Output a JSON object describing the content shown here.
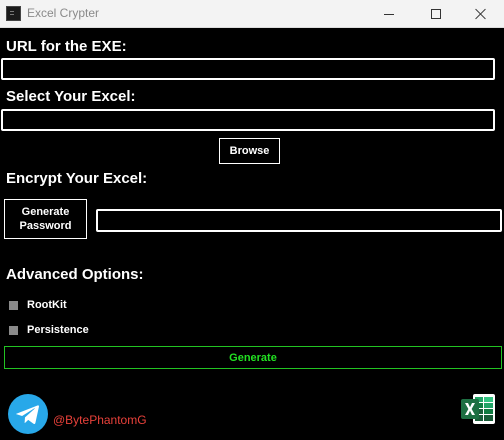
{
  "window": {
    "title": "Excel Crypter",
    "controls": [
      "minimize-icon",
      "maximize-icon",
      "close-icon"
    ]
  },
  "url_section": {
    "label": "URL for the EXE:",
    "value": ""
  },
  "excel_section": {
    "label": "Select Your Excel:",
    "value": "",
    "browse_label": "Browse"
  },
  "encrypt_section": {
    "label": "Encrypt Your Excel:",
    "generate_password_line1": "Generate",
    "generate_password_line2": "Password",
    "password_value": ""
  },
  "advanced": {
    "label": "Advanced Options:",
    "options": [
      {
        "label": "RootKit",
        "checked": false
      },
      {
        "label": "Persistence",
        "checked": false
      }
    ]
  },
  "generate_label": "Generate",
  "footer": {
    "handle": "@BytePhantomG",
    "icons": [
      "telegram-icon",
      "excel-icon"
    ]
  },
  "colors": {
    "background": "#000000",
    "accent_green": "#22e022",
    "handle_red": "#e8413a",
    "telegram_blue": "#28a8e9",
    "excel_green": "#1d6f42"
  }
}
